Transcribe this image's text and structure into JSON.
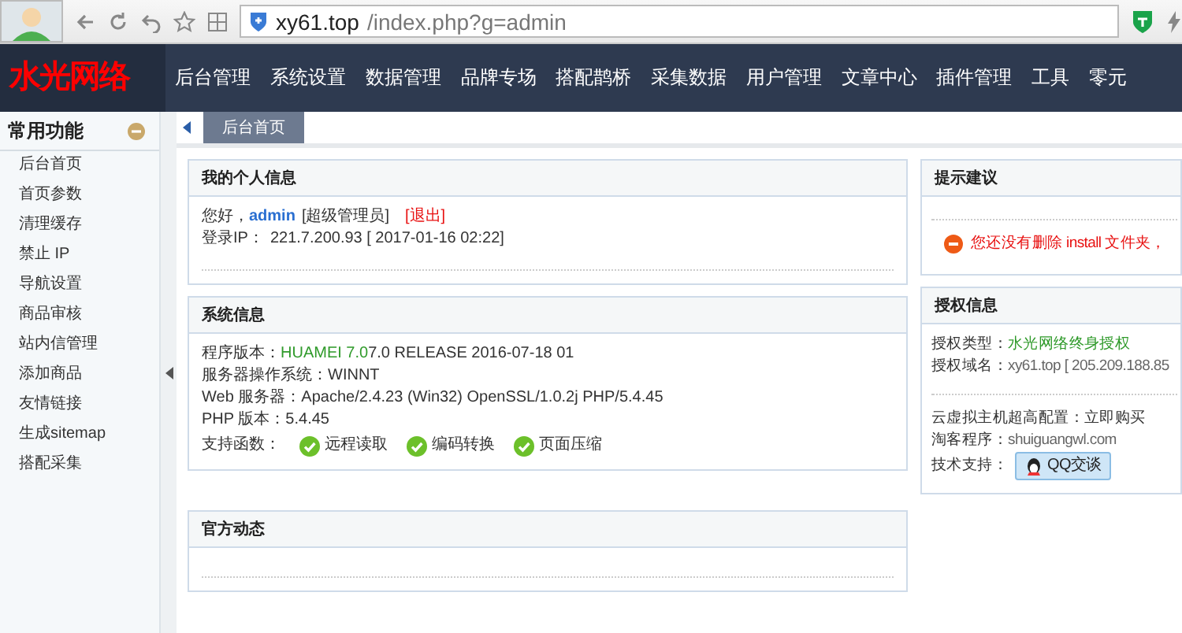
{
  "browser": {
    "url_domain": "xy61.top",
    "url_path": "/index.php?g=admin"
  },
  "logo": "水光网络",
  "nav": [
    {
      "label": "后台管理"
    },
    {
      "label": "系统设置"
    },
    {
      "label": "数据管理"
    },
    {
      "label": "品牌专场"
    },
    {
      "label": "搭配鹊桥"
    },
    {
      "label": "采集数据"
    },
    {
      "label": "用户管理"
    },
    {
      "label": "文章中心"
    },
    {
      "label": "插件管理"
    },
    {
      "label": "工具"
    },
    {
      "label": "零元"
    }
  ],
  "sidebar": {
    "title": "常用功能",
    "expanded": true,
    "items": [
      "后台首页",
      "首页参数",
      "清理缓存",
      "禁止 IP",
      "导航设置",
      "商品审核",
      "站内信管理",
      "添加商品",
      "友情链接",
      "生成sitemap",
      "搭配采集"
    ]
  },
  "tabs": [
    {
      "label": "后台首页",
      "selected": true
    }
  ],
  "profile": {
    "title": "我的个人信息",
    "greeting": "您好，",
    "user": "admin",
    "role": "[超级管理员]",
    "logout": "[退出]",
    "login_label": "登录IP：",
    "login_value": "221.7.200.93 [ 2017-01-16 02:22]"
  },
  "system": {
    "title": "系统信息",
    "rows": [
      {
        "label": "程序版本：",
        "highlight": "HUAMEI 7.0",
        "value": "7.0 RELEASE 2016-07-18 01"
      },
      {
        "label": "服务器操作系统：",
        "value": "WINNT"
      },
      {
        "label": "Web 服务器：",
        "value": "Apache/2.4.23 (Win32) OpenSSL/1.0.2j PHP/5.4.45"
      },
      {
        "label": "PHP 版本：",
        "value": "5.4.45"
      }
    ],
    "support_label": "支持函数：",
    "support": [
      {
        "label": "远程读取",
        "ok": true
      },
      {
        "label": "编码转换",
        "ok": true
      },
      {
        "label": "页面压缩",
        "ok": true
      }
    ]
  },
  "news": {
    "title": "官方动态"
  },
  "tips": {
    "title": "提示建议",
    "warning": "您还没有删除 install 文件夹，"
  },
  "license": {
    "title": "授权信息",
    "type_label": "授权类型：",
    "type_value": "水光网络终身授权",
    "domain_label": "授权域名：",
    "domain_value": "xy61.top [ 205.209.188.85",
    "host_label": "云虚拟主机超高配置：",
    "host_link": "立即购买",
    "shop_label": "淘客程序：",
    "shop_link": "shuiguangwl.com",
    "support_label": "技术支持：",
    "qq_button": "QQ交谈"
  }
}
